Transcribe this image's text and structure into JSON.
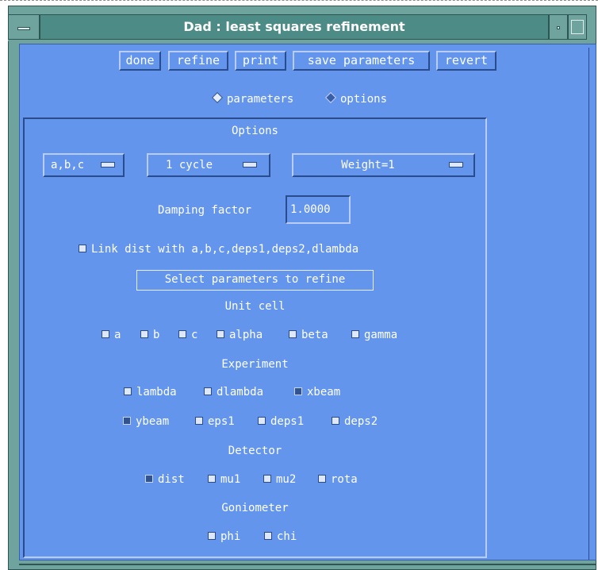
{
  "window": {
    "title": "Dad : least squares refinement"
  },
  "toolbar": {
    "done": "done",
    "refine": "refine",
    "print": "print",
    "save_parameters": "save parameters",
    "revert": "revert"
  },
  "mode": {
    "selected": "options",
    "parameters_label": "parameters",
    "options_label": "options"
  },
  "options": {
    "heading": "Options",
    "cell_menu": "a,b,c",
    "cycle_menu": "1 cycle",
    "weight_menu": "Weight=1",
    "damping_label": "Damping factor",
    "damping_value": "1.0000",
    "link_label": "Link dist with a,b,c,deps1,deps2,dlambda",
    "link_checked": false,
    "select_button": "Select parameters to refine"
  },
  "groups": {
    "unit_cell": {
      "heading": "Unit cell",
      "items": [
        {
          "label": "a",
          "checked": false
        },
        {
          "label": "b",
          "checked": false
        },
        {
          "label": "c",
          "checked": false
        },
        {
          "label": "alpha",
          "checked": false
        },
        {
          "label": "beta",
          "checked": false
        },
        {
          "label": "gamma",
          "checked": false
        }
      ]
    },
    "experiment": {
      "heading": "Experiment",
      "items": [
        {
          "label": "lambda",
          "checked": false
        },
        {
          "label": "dlambda",
          "checked": false
        },
        {
          "label": "xbeam",
          "checked": true
        },
        {
          "label": "ybeam",
          "checked": true
        },
        {
          "label": "eps1",
          "checked": false
        },
        {
          "label": "deps1",
          "checked": false
        },
        {
          "label": "deps2",
          "checked": false
        }
      ]
    },
    "detector": {
      "heading": "Detector",
      "items": [
        {
          "label": "dist",
          "checked": true
        },
        {
          "label": "mu1",
          "checked": false
        },
        {
          "label": "mu2",
          "checked": false
        },
        {
          "label": "rota",
          "checked": false
        }
      ]
    },
    "goniometer": {
      "heading": "Goniometer",
      "items": [
        {
          "label": "phi",
          "checked": false
        },
        {
          "label": "chi",
          "checked": false
        }
      ]
    }
  },
  "colors": {
    "dialog_background": "#6495ed",
    "frame": "#6fa49e",
    "title_background": "#4d8c86",
    "text": "#ffffff"
  }
}
